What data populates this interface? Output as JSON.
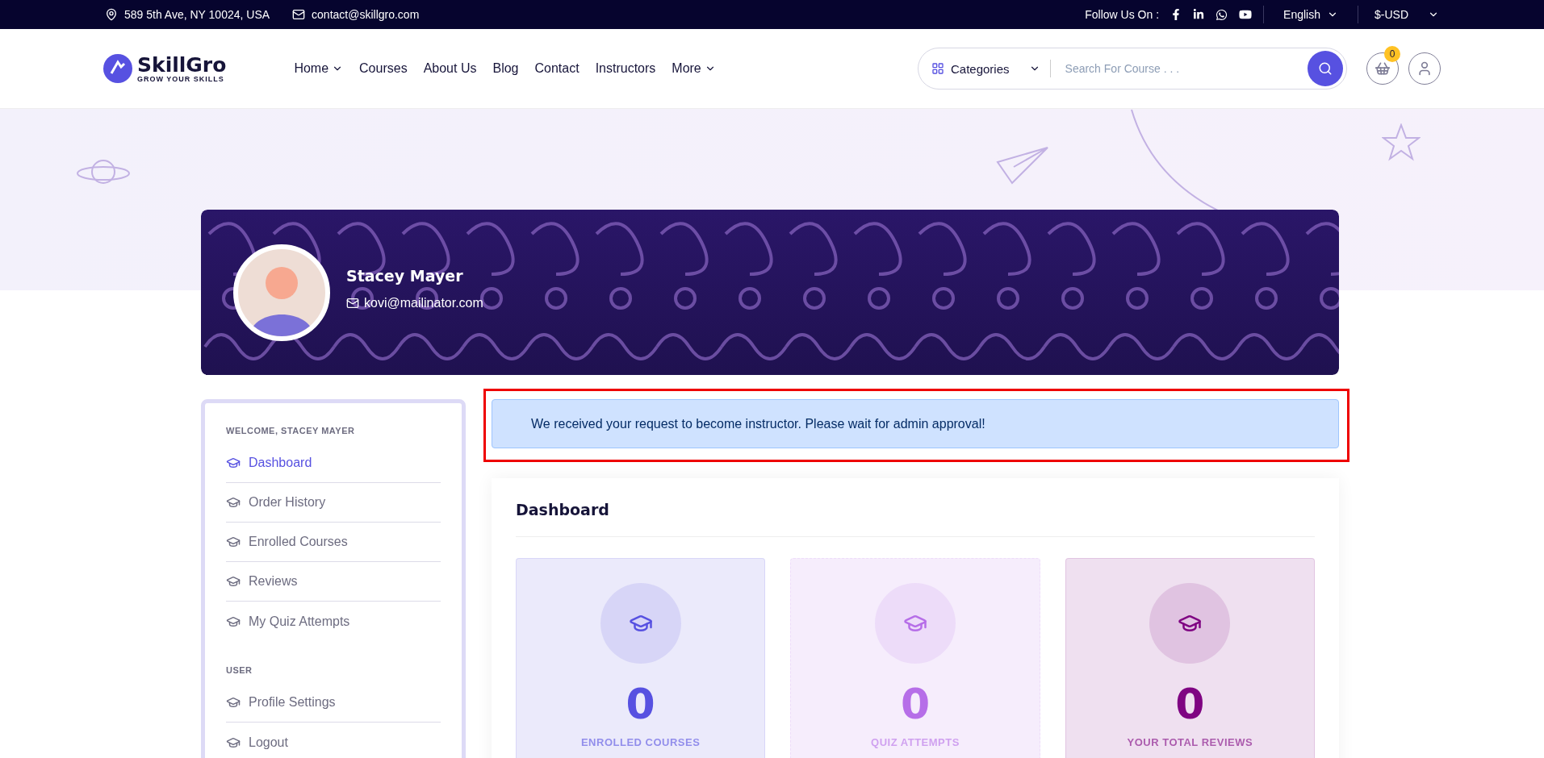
{
  "top_bar": {
    "address": "589 5th Ave, NY 10024, USA",
    "email": "contact@skillgro.com",
    "follow_label": "Follow Us On :",
    "language": "English",
    "currency": "$-USD"
  },
  "header": {
    "logo_name": "SkillGro",
    "logo_tagline": "GROW YOUR SKILLS",
    "nav": [
      {
        "label": "Home",
        "dropdown": true
      },
      {
        "label": "Courses",
        "dropdown": false
      },
      {
        "label": "About Us",
        "dropdown": false
      },
      {
        "label": "Blog",
        "dropdown": false
      },
      {
        "label": "Contact",
        "dropdown": false
      },
      {
        "label": "Instructors",
        "dropdown": false
      },
      {
        "label": "More",
        "dropdown": true
      }
    ],
    "categories_label": "Categories",
    "search_placeholder": "Search For Course . . .",
    "cart_count": "0"
  },
  "profile": {
    "name": "Stacey Mayer",
    "email": "kovi@mailinator.com"
  },
  "sidebar": {
    "sections": [
      {
        "title": "WELCOME, STACEY MAYER",
        "items": [
          {
            "label": "Dashboard",
            "selected": true
          },
          {
            "label": "Order History",
            "selected": false
          },
          {
            "label": "Enrolled Courses",
            "selected": false
          },
          {
            "label": "Reviews",
            "selected": false
          },
          {
            "label": "My Quiz Attempts",
            "selected": false
          }
        ]
      },
      {
        "title": "USER",
        "items": [
          {
            "label": "Profile Settings",
            "selected": false
          },
          {
            "label": "Logout",
            "selected": false
          }
        ]
      }
    ]
  },
  "alert": {
    "message": "We received your request to become instructor. Please wait for admin approval!",
    "highlighted": true
  },
  "dashboard": {
    "title": "Dashboard",
    "stats": [
      {
        "value": "0",
        "label": "ENROLLED COURSES",
        "color": "#5751e1"
      },
      {
        "value": "0",
        "label": "QUIZ ATTEMPTS",
        "color": "#b66ee8"
      },
      {
        "value": "0",
        "label": "YOUR TOTAL REVIEWS",
        "color": "#7f0482"
      }
    ]
  }
}
